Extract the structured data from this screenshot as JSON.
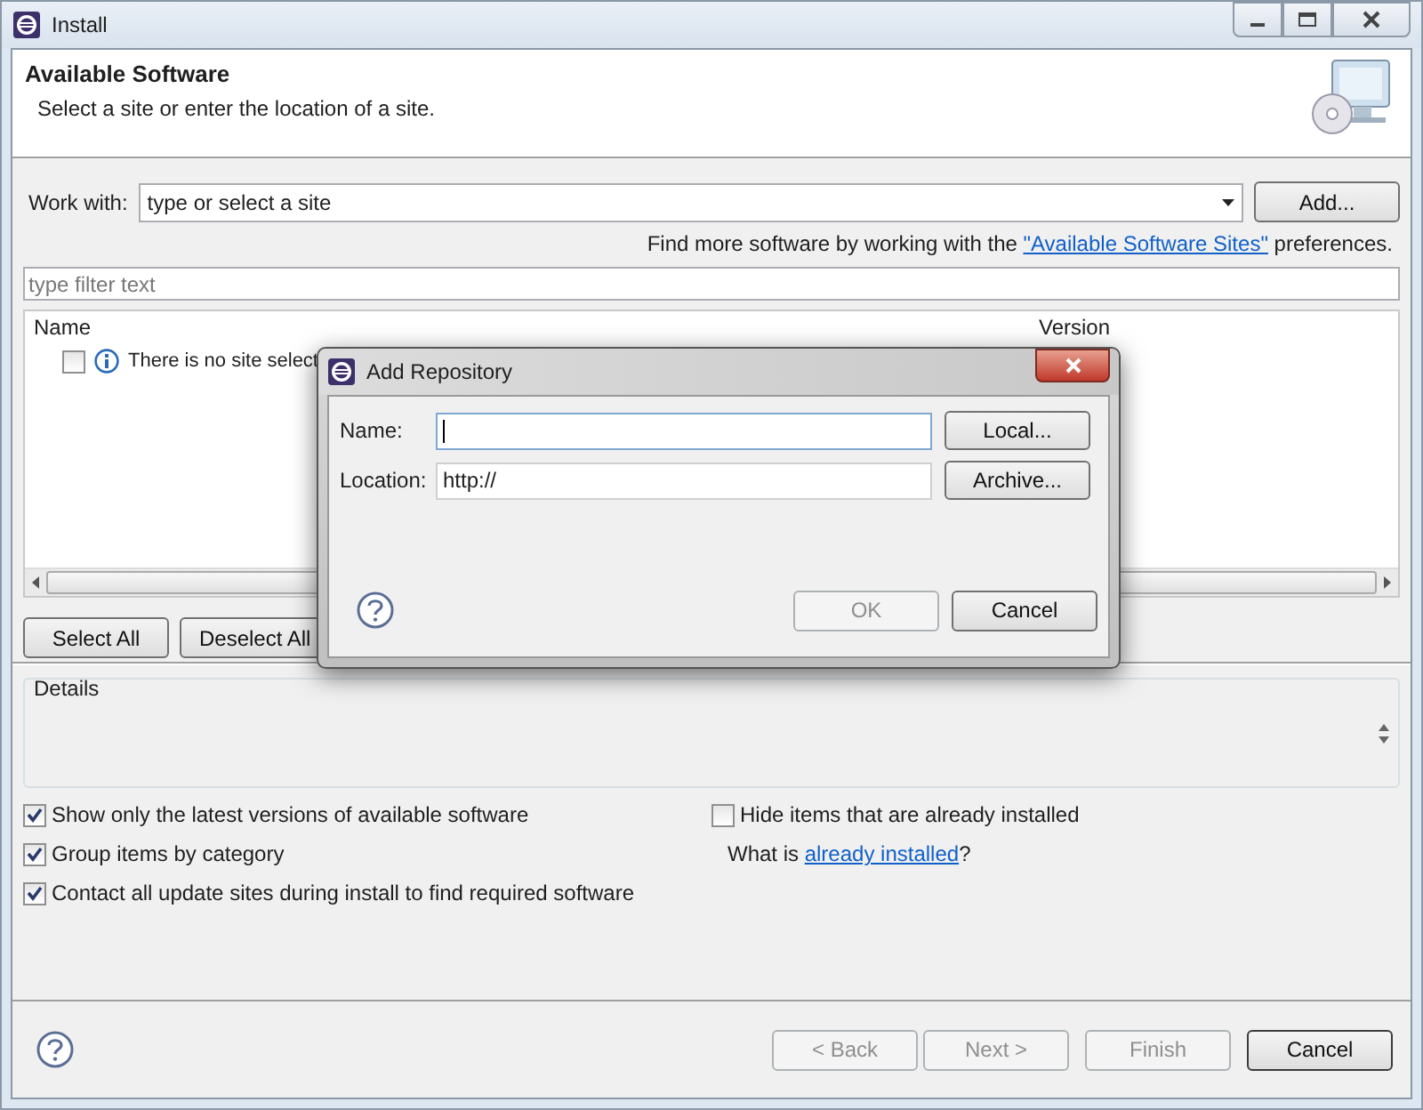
{
  "window": {
    "title": "Install"
  },
  "header": {
    "title": "Available Software",
    "subtitle": "Select a site or enter the location of a site."
  },
  "work_with": {
    "label": "Work with:",
    "value": "type or select a site",
    "button": "Add..."
  },
  "more_info": {
    "before": "Find more software by working with the ",
    "link": "\"Available Software Sites\"",
    "after": " preferences."
  },
  "filter": {
    "placeholder": "type filter text"
  },
  "table": {
    "columns": [
      "Name",
      "Version"
    ],
    "rows": [
      {
        "checked": false,
        "text": "There is no site select"
      }
    ]
  },
  "selection_buttons": [
    "Select All",
    "Deselect All"
  ],
  "details": {
    "label": "Details"
  },
  "options": [
    {
      "label": "Show only the latest versions of available software",
      "checked": true
    },
    {
      "label": "Group items by category",
      "checked": true
    },
    {
      "label": "Contact all update sites during install to find required software",
      "checked": true
    }
  ],
  "side_options": [
    {
      "label": "Hide items that are already installed",
      "checked": false
    }
  ],
  "installed_note": {
    "before": "What is ",
    "link": "already installed",
    "after": "?"
  },
  "footer_buttons": [
    {
      "label": "< Back",
      "disabled": true
    },
    {
      "label": "Next >",
      "disabled": true
    },
    {
      "label": "Finish",
      "disabled": true
    },
    {
      "label": "Cancel",
      "disabled": false
    }
  ],
  "dialog": {
    "title": "Add Repository",
    "fields": [
      {
        "label": "Name:",
        "button": "Local...",
        "focused": true
      },
      {
        "label": "Location:",
        "value": "http://",
        "button": "Archive...",
        "focused": false
      }
    ],
    "buttons": [
      {
        "label": "OK",
        "disabled": true
      },
      {
        "label": "Cancel",
        "disabled": false
      }
    ]
  }
}
